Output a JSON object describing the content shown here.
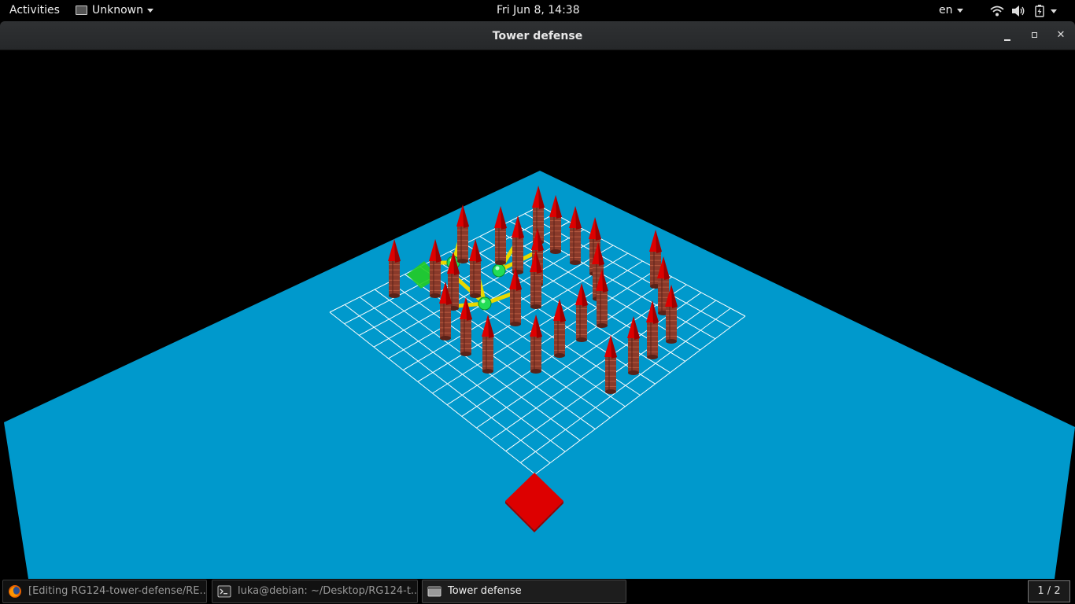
{
  "topbar": {
    "activities": "Activities",
    "app_menu": "Unknown",
    "clock": "Fri Jun  8, 14:38",
    "language": "en"
  },
  "window": {
    "title": "Tower defense"
  },
  "taskbar": {
    "tasks": [
      {
        "label": "[Editing RG124-tower-defense/RE...",
        "icon": "firefox-icon",
        "active": false
      },
      {
        "label": "luka@debian: ~/Desktop/RG124-t...",
        "icon": "terminal-icon",
        "active": false
      },
      {
        "label": "Tower defense",
        "icon": "window-icon",
        "active": true
      }
    ],
    "workspace": "1 / 2"
  },
  "colors": {
    "ground": "#0099cc",
    "grid_line": "#ffffff",
    "tower_body": "#8a3a2a",
    "tower_top": "#dd0000",
    "base": "#dd0000",
    "spawn": "#22cc22",
    "enemy": "#22dd55",
    "laser": "#e8d800"
  }
}
